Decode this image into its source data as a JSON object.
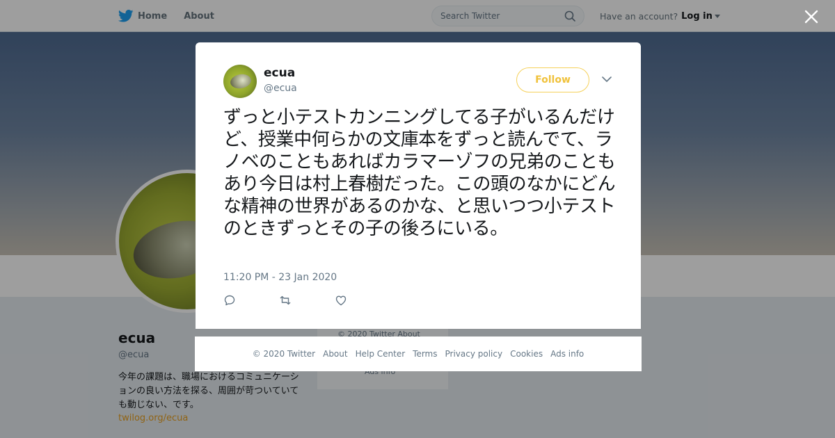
{
  "topnav": {
    "home_label": "Home",
    "about_label": "About",
    "search_placeholder": "Search Twitter",
    "account_prompt": "Have an account?",
    "login_label": "Log in"
  },
  "profile": {
    "name": "ecua",
    "handle": "@ecua",
    "bio": "今年の課題は、職場におけるコミュニケーションの良い方法を探る、周囲が苛ついていても動じない、です。",
    "link": "twilog.org/ecua",
    "sidebar_footer_a": "© 2020 Twitter   About",
    "sidebar_footer_b": "Ads info"
  },
  "tweet": {
    "author_name": "ecua",
    "author_handle": "@ecua",
    "follow_label": "Follow",
    "text": "ずっと小テストカンニングしてる子がいるんだけど、授業中何らかの文庫本をずっと読んでて、ラノベのこともあればカラマーゾフの兄弟のこともあり今日は村上春樹だった。この頭のなかにどんな精神の世界があるのかな、と思いつつ小テストのときずっとその子の後ろにいる。",
    "timestamp": "11:20 PM - 23 Jan 2020"
  },
  "footer": {
    "links": [
      "© 2020 Twitter",
      "About",
      "Help Center",
      "Terms",
      "Privacy policy",
      "Cookies",
      "Ads info"
    ]
  },
  "colors": {
    "twitter_blue": "#1da1f2",
    "follow_yellow": "#f0c23c",
    "muted": "#657786",
    "link_orange": "#e8a020"
  },
  "icons": {
    "logo": "twitter-bird-icon",
    "home": "home-icon",
    "search": "search-icon",
    "close": "close-icon",
    "menu": "chevron-down-icon",
    "reply": "reply-icon",
    "retweet": "retweet-icon",
    "like": "heart-icon"
  }
}
